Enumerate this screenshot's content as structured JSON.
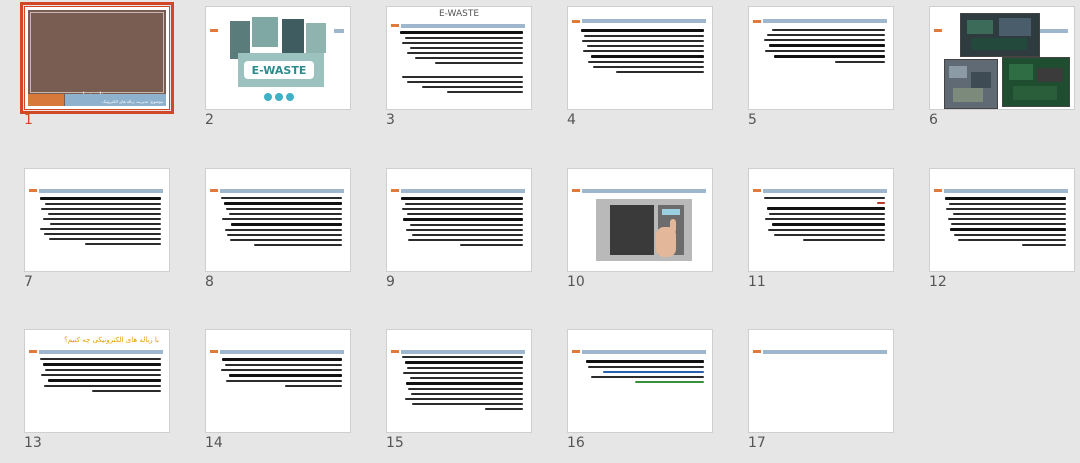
{
  "slides": [
    {
      "number": "1",
      "title": "به نام خدا",
      "subtitle": "موضوع: مدیریت زباله های الکترونیک",
      "selected": true
    },
    {
      "number": "2",
      "title": "E-WASTE"
    },
    {
      "number": "3",
      "title": "E-WASTE"
    },
    {
      "number": "4"
    },
    {
      "number": "5"
    },
    {
      "number": "6"
    },
    {
      "number": "7"
    },
    {
      "number": "8"
    },
    {
      "number": "9"
    },
    {
      "number": "10"
    },
    {
      "number": "11"
    },
    {
      "number": "12"
    },
    {
      "number": "13",
      "title": "با زباله های الکترونیکی چه کنیم؟"
    },
    {
      "number": "14"
    },
    {
      "number": "15"
    },
    {
      "number": "16"
    },
    {
      "number": "17"
    }
  ],
  "colors": {
    "accent_selected": "#d24726",
    "header_orange": "#e07a3b",
    "header_blue": "#9fb7cc",
    "slide1_background": "#7a5d52"
  },
  "icons": {
    "hand_icon": "hand-pointer-icon"
  }
}
